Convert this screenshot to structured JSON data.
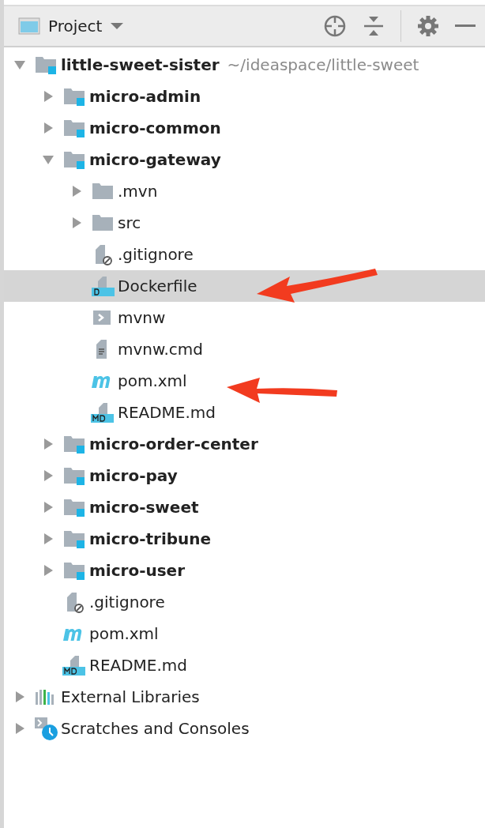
{
  "panel": {
    "title": "Project"
  },
  "tree": [
    {
      "name": "little-sweet-sister",
      "path": "~/ideaspace/little-sweet",
      "kind": "module",
      "expanded": true,
      "selected": false,
      "children": [
        {
          "name": "micro-admin",
          "kind": "module",
          "expanded": false,
          "selected": false
        },
        {
          "name": "micro-common",
          "kind": "module",
          "expanded": false,
          "selected": false
        },
        {
          "name": "micro-gateway",
          "kind": "module",
          "expanded": true,
          "selected": false,
          "children": [
            {
              "name": ".mvn",
              "kind": "folder",
              "expanded": false,
              "selected": false
            },
            {
              "name": "src",
              "kind": "folder",
              "expanded": false,
              "selected": false
            },
            {
              "name": ".gitignore",
              "kind": "ignore",
              "selected": false
            },
            {
              "name": "Dockerfile",
              "kind": "docker",
              "selected": true
            },
            {
              "name": "mvnw",
              "kind": "shell",
              "selected": false
            },
            {
              "name": "mvnw.cmd",
              "kind": "text",
              "selected": false
            },
            {
              "name": "pom.xml",
              "kind": "maven",
              "selected": false
            },
            {
              "name": "README.md",
              "kind": "markdown",
              "selected": false
            }
          ]
        },
        {
          "name": "micro-order-center",
          "kind": "module",
          "expanded": false,
          "selected": false
        },
        {
          "name": "micro-pay",
          "kind": "module",
          "expanded": false,
          "selected": false
        },
        {
          "name": "micro-sweet",
          "kind": "module",
          "expanded": false,
          "selected": false
        },
        {
          "name": "micro-tribune",
          "kind": "module",
          "expanded": false,
          "selected": false
        },
        {
          "name": "micro-user",
          "kind": "module",
          "expanded": false,
          "selected": false
        },
        {
          "name": ".gitignore",
          "kind": "ignore",
          "selected": false
        },
        {
          "name": "pom.xml",
          "kind": "maven",
          "selected": false
        },
        {
          "name": "README.md",
          "kind": "markdown",
          "selected": false
        }
      ]
    },
    {
      "name": "External Libraries",
      "kind": "libraries",
      "expanded": false,
      "selected": false
    },
    {
      "name": "Scratches and Consoles",
      "kind": "scratches",
      "expanded": false,
      "selected": false
    }
  ]
}
